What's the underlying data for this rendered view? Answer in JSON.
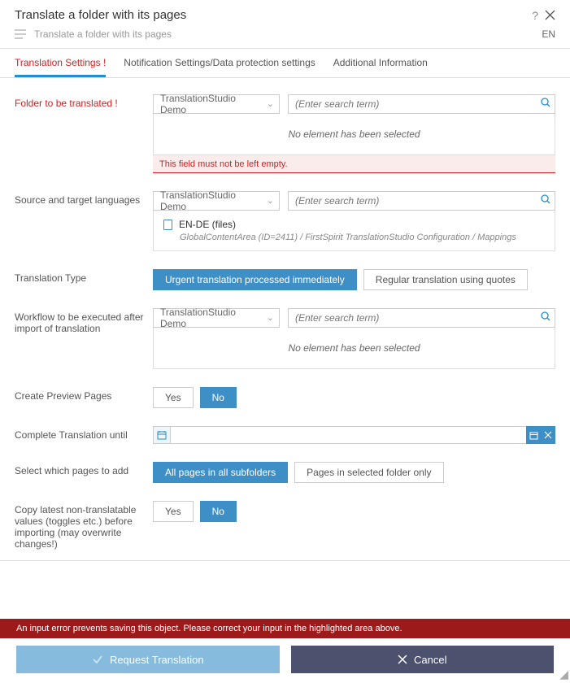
{
  "header": {
    "title": "Translate a folder with its pages",
    "subtitle": "Translate a folder with its pages",
    "lang": "EN"
  },
  "tabs": {
    "t1": "Translation Settings !",
    "t2": "Notification Settings/Data protection settings",
    "t3": "Additional Information"
  },
  "labels": {
    "folder": "Folder to be translated !",
    "languages": "Source and target languages",
    "transType": "Translation Type",
    "workflow": "Workflow to be executed after import of translation",
    "preview": "Create Preview Pages",
    "complete": "Complete Translation until",
    "pagesAdd": "Select which pages to add",
    "copyLatest": "Copy latest non-translatable values (toggles etc.) before importing (may overwrite changes!)"
  },
  "controls": {
    "selectPlaceholder": "TranslationStudio Demo",
    "searchPlaceholder": "(Enter search term)",
    "emptySel": "No element has been selected",
    "fieldEmptyErr": "This field must not be left empty.",
    "langItem": "EN-DE (files)",
    "langPath": "GlobalContentArea (ID=2411) / FirstSpirit TranslationStudio Configuration / Mappings",
    "typeUrgent": "Urgent translation processed immediately",
    "typeRegular": "Regular translation using quotes",
    "yes": "Yes",
    "no": "No",
    "pagesAll": "All pages in all subfolders",
    "pagesSel": "Pages in selected folder only"
  },
  "errorBar": "An input error prevents saving this object. Please correct your input in the highlighted area above.",
  "footer": {
    "request": "Request Translation",
    "cancel": "Cancel"
  }
}
